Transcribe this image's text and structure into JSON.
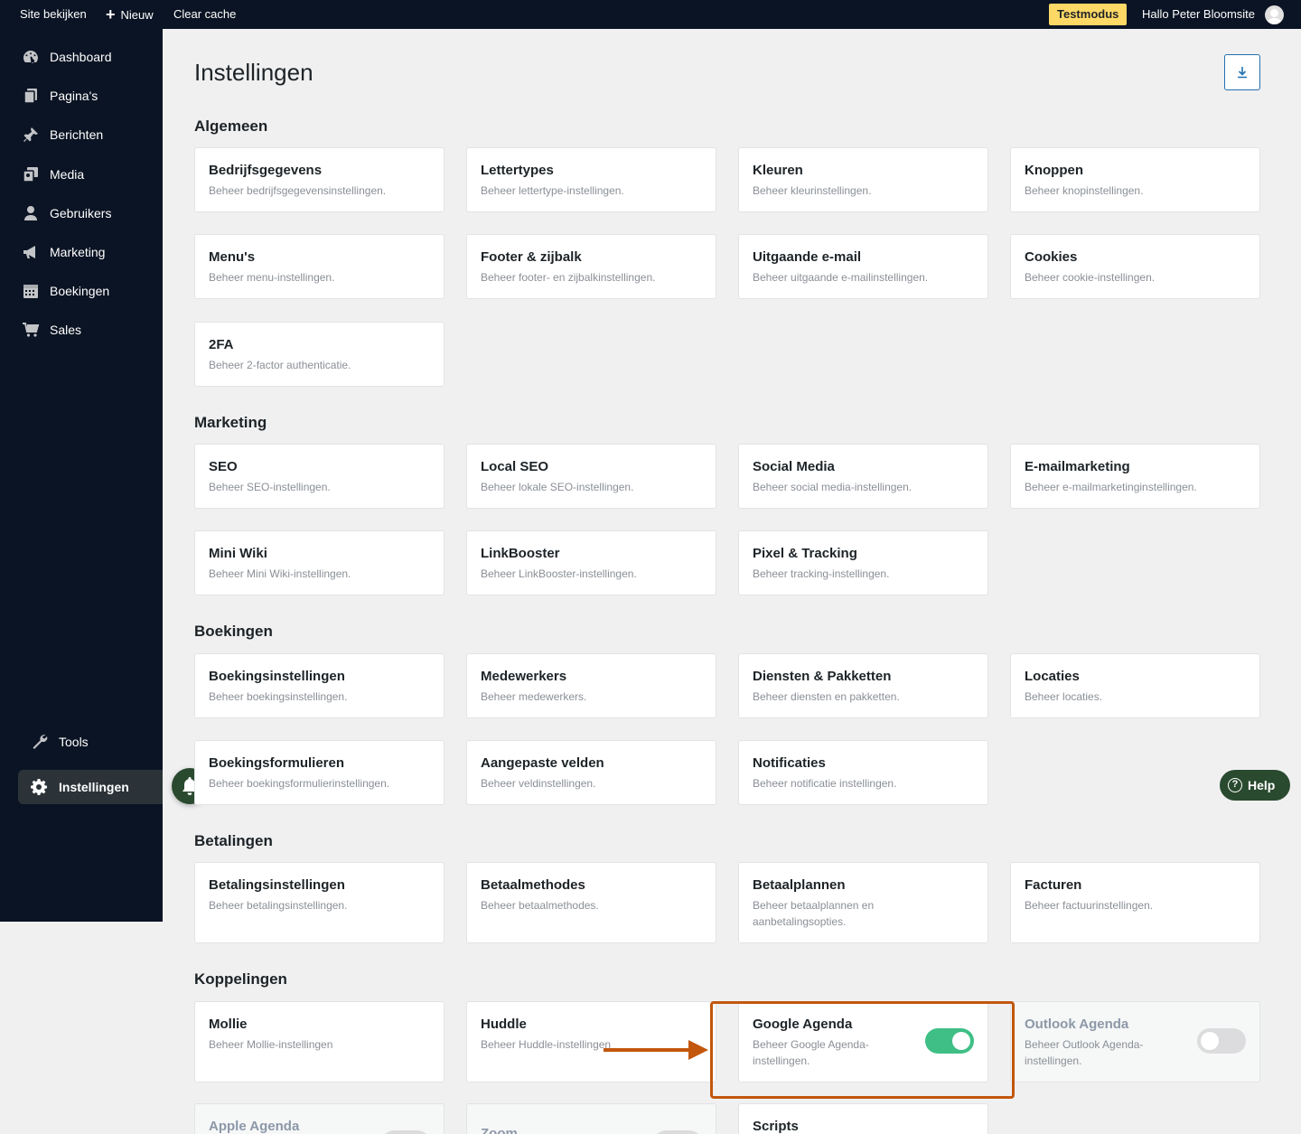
{
  "topbar": {
    "site_label": "Site bekijken",
    "new_label": "Nieuw",
    "cache_label": "Clear cache",
    "test_badge": "Testmodus",
    "greeting": "Hallo Peter Bloomsite"
  },
  "sidebar": {
    "items": [
      {
        "label": "Dashboard",
        "icon": "dashboard-icon"
      },
      {
        "label": "Pagina's",
        "icon": "pages-icon"
      },
      {
        "label": "Berichten",
        "icon": "pin-icon"
      },
      {
        "label": "Media",
        "icon": "media-icon"
      },
      {
        "label": "Gebruikers",
        "icon": "user-icon"
      },
      {
        "label": "Marketing",
        "icon": "megaphone-icon"
      },
      {
        "label": "Boekingen",
        "icon": "calendar-icon"
      },
      {
        "label": "Sales",
        "icon": "cart-icon"
      }
    ],
    "tools_label": "Tools",
    "settings_label": "Instellingen"
  },
  "page": {
    "title": "Instellingen",
    "help_label": "Help"
  },
  "sections": {
    "algemeen": {
      "title": "Algemeen",
      "cards": [
        {
          "title": "Bedrijfsgegevens",
          "desc": "Beheer bedrijfsgegevensinstellingen."
        },
        {
          "title": "Lettertypes",
          "desc": "Beheer lettertype-instellingen."
        },
        {
          "title": "Kleuren",
          "desc": "Beheer kleurinstellingen."
        },
        {
          "title": "Knoppen",
          "desc": "Beheer knopinstellingen."
        },
        {
          "title": "Menu's",
          "desc": "Beheer menu-instellingen."
        },
        {
          "title": "Footer & zijbalk",
          "desc": "Beheer footer- en zijbalkinstellingen."
        },
        {
          "title": "Uitgaande e-mail",
          "desc": "Beheer uitgaande e-mailinstellingen."
        },
        {
          "title": "Cookies",
          "desc": "Beheer cookie-instellingen."
        },
        {
          "title": "2FA",
          "desc": "Beheer 2-factor authenticatie."
        }
      ]
    },
    "marketing": {
      "title": "Marketing",
      "cards": [
        {
          "title": "SEO",
          "desc": "Beheer SEO-instellingen."
        },
        {
          "title": "Local SEO",
          "desc": "Beheer lokale SEO-instellingen."
        },
        {
          "title": "Social Media",
          "desc": "Beheer social media-instellingen."
        },
        {
          "title": "E-mailmarketing",
          "desc": "Beheer e-mailmarketinginstellingen."
        },
        {
          "title": "Mini Wiki",
          "desc": "Beheer Mini Wiki-instellingen."
        },
        {
          "title": "LinkBooster",
          "desc": "Beheer LinkBooster-instellingen."
        },
        {
          "title": "Pixel & Tracking",
          "desc": "Beheer tracking-instellingen."
        }
      ]
    },
    "boekingen": {
      "title": "Boekingen",
      "cards": [
        {
          "title": "Boekingsinstellingen",
          "desc": "Beheer boekingsinstellingen."
        },
        {
          "title": "Medewerkers",
          "desc": "Beheer medewerkers."
        },
        {
          "title": "Diensten & Pakketten",
          "desc": "Beheer diensten en pakketten."
        },
        {
          "title": "Locaties",
          "desc": "Beheer locaties."
        },
        {
          "title": "Boekingsformulieren",
          "desc": "Beheer boekingsformulierinstellingen."
        },
        {
          "title": "Aangepaste velden",
          "desc": "Beheer veldinstellingen."
        },
        {
          "title": "Notificaties",
          "desc": "Beheer notificatie instellingen."
        }
      ]
    },
    "betalingen": {
      "title": "Betalingen",
      "cards": [
        {
          "title": "Betalingsinstellingen",
          "desc": "Beheer betalingsinstellingen."
        },
        {
          "title": "Betaalmethodes",
          "desc": "Beheer betaalmethodes."
        },
        {
          "title": "Betaalplannen",
          "desc": "Beheer betaalplannen en aanbetalingsopties."
        },
        {
          "title": "Facturen",
          "desc": "Beheer factuurinstellingen."
        }
      ]
    },
    "koppelingen": {
      "title": "Koppelingen",
      "cards": [
        {
          "title": "Mollie",
          "desc": "Beheer Mollie-instellingen"
        },
        {
          "title": "Huddle",
          "desc": "Beheer Huddle-instellingen"
        },
        {
          "title": "Google Agenda",
          "desc": "Beheer Google Agenda-instellingen.",
          "enabled": true
        },
        {
          "title": "Outlook Agenda",
          "desc": "Beheer Outlook Agenda-instellingen.",
          "enabled": false
        },
        {
          "title": "Apple Agenda",
          "desc": "",
          "enabled": false
        },
        {
          "title": "Zoom",
          "desc": "",
          "enabled": false
        },
        {
          "title": "Scripts",
          "desc": ""
        }
      ]
    }
  },
  "colors": {
    "admin_bar": "#0b1424",
    "toggle_on": "#3fbf86",
    "highlight": "#c2570c",
    "badge": "#ffd966",
    "accent": "#2271b1"
  }
}
